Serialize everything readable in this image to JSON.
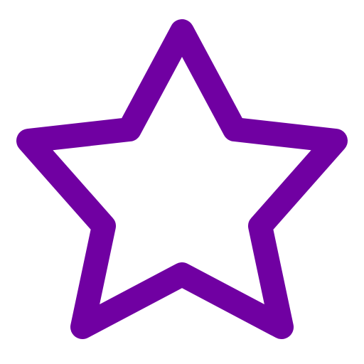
{
  "icon": {
    "name": "star-outline-icon",
    "state": "unfilled",
    "stroke_color": "#7000A2",
    "fill_color": "#FFFFFF"
  }
}
